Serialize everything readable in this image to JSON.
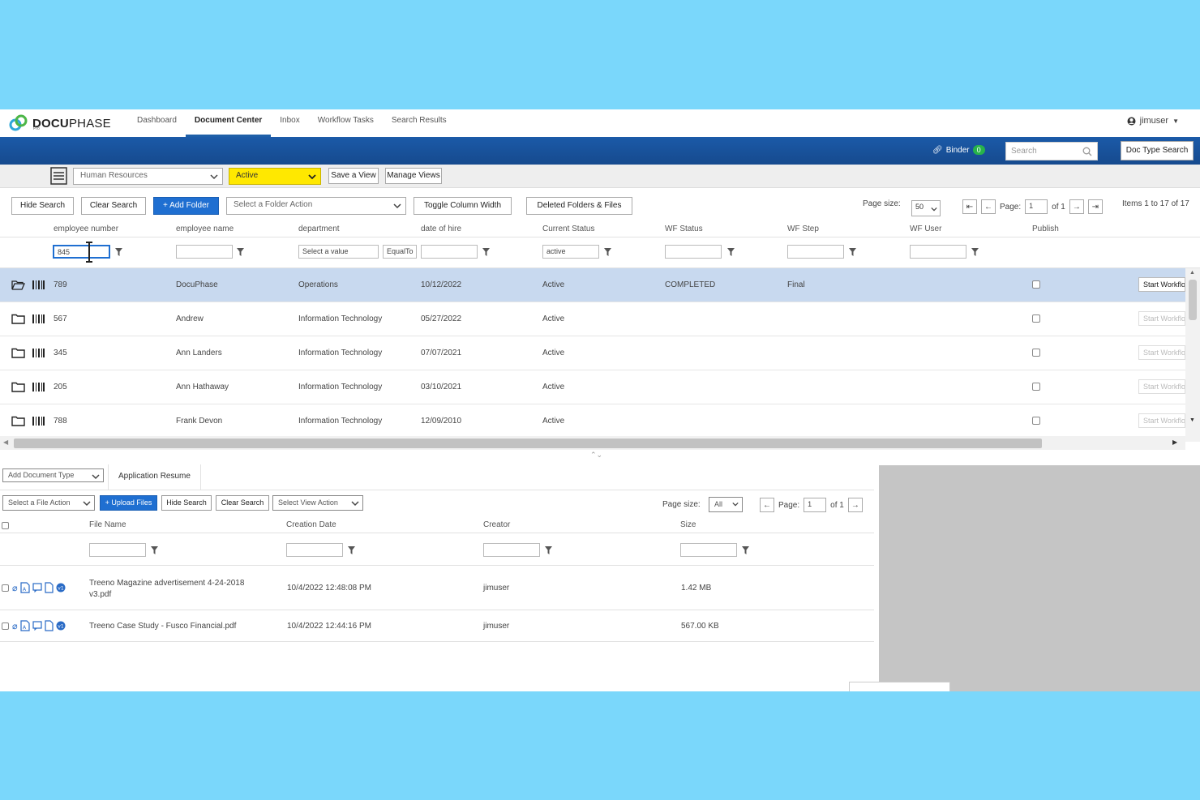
{
  "app": {
    "logo_bold": "DOCU",
    "logo_regular": "PHASE",
    "logo_sub": "Pro",
    "nav": [
      "Dashboard",
      "Document Center",
      "Inbox",
      "Workflow Tasks",
      "Search Results"
    ],
    "active_nav": "Document Center",
    "user": "jimuser"
  },
  "bluebar": {
    "binder_label": "Binder",
    "binder_count": "0",
    "search_placeholder": "Search",
    "doc_type_search": "Doc Type Search"
  },
  "viewbar": {
    "folder_type": "Human Resources",
    "view": "Active",
    "save_view": "Save a View",
    "manage_views": "Manage Views"
  },
  "toolbar": {
    "hide_search": "Hide Search",
    "clear_search": "Clear Search",
    "add_folder": "+ Add Folder",
    "folder_action_placeholder": "Select a Folder Action",
    "toggle_column_width": "Toggle Column Width",
    "deleted_folders": "Deleted Folders & Files",
    "page_size_label": "Page size:",
    "page_size": "50",
    "page_label": "Page:",
    "page": "1",
    "of_pages": "of 1",
    "items_info": "Items 1 to 17 of 17"
  },
  "grid": {
    "columns": [
      "employee number",
      "employee name",
      "department",
      "date of hire",
      "Current Status",
      "WF Status",
      "WF Step",
      "WF User",
      "Publish"
    ],
    "filters": {
      "employee_number": "845",
      "department_placeholder": "Select a value",
      "department_op": "EqualTo",
      "current_status": "active"
    },
    "start_workflow_label": "Start Workflow",
    "rows": [
      {
        "number": "789",
        "name": "DocuPhase",
        "department": "Operations",
        "hire": "10/12/2022",
        "status": "Active",
        "wf_status": "COMPLETED",
        "wf_step": "Final"
      },
      {
        "number": "567",
        "name": "Andrew",
        "department": "Information Technology",
        "hire": "05/27/2022",
        "status": "Active",
        "wf_status": "",
        "wf_step": ""
      },
      {
        "number": "345",
        "name": "Ann Landers",
        "department": "Information Technology",
        "hire": "07/07/2021",
        "status": "Active",
        "wf_status": "",
        "wf_step": ""
      },
      {
        "number": "205",
        "name": "Ann Hathaway",
        "department": "Information Technology",
        "hire": "03/10/2021",
        "status": "Active",
        "wf_status": "",
        "wf_step": ""
      },
      {
        "number": "788",
        "name": "Frank Devon",
        "department": "Information Technology",
        "hire": "12/09/2010",
        "status": "Active",
        "wf_status": "",
        "wf_step": ""
      }
    ]
  },
  "docs": {
    "add_document_type": "Add Document Type",
    "tab": "Application Resume",
    "file_action": "Select a File Action",
    "upload_files": "+ Upload Files",
    "hide_search": "Hide Search",
    "clear_search": "Clear Search",
    "view_action": "Select View Action",
    "page_size_label": "Page size:",
    "page_size": "All",
    "page_label": "Page:",
    "page": "1",
    "of_pages": "of 1",
    "columns": [
      "File Name",
      "Creation Date",
      "Creator",
      "Size"
    ],
    "files": [
      {
        "name": "Treeno Magazine advertisement 4-24-2018 v3.pdf",
        "date": "10/4/2022 12:48:08 PM",
        "creator": "jimuser",
        "size": "1.42 MB"
      },
      {
        "name": "Treeno Case Study - Fusco Financial.pdf",
        "date": "10/4/2022 12:44:16 PM",
        "creator": "jimuser",
        "size": "567.00 KB"
      }
    ]
  }
}
